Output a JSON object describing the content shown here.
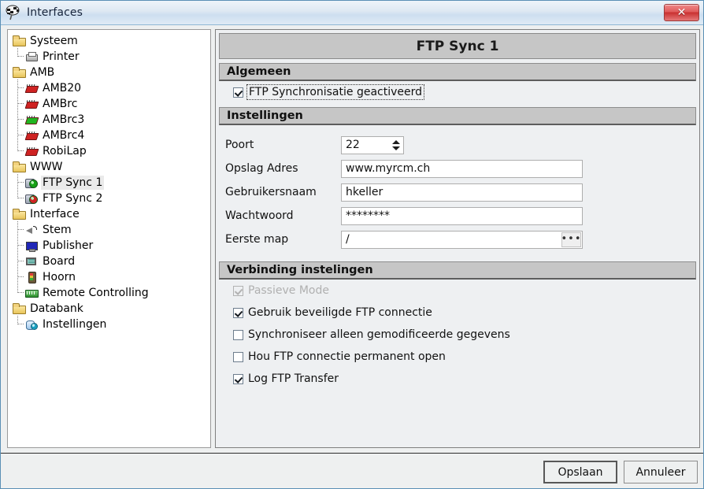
{
  "window": {
    "title": "Interfaces",
    "title_icon": "interfaces-icon",
    "close_label": "✕"
  },
  "tree": {
    "nodes": [
      {
        "label": "Systeem",
        "icon": "folder-icon",
        "level": 0,
        "selected": false
      },
      {
        "label": "Printer",
        "icon": "printer-icon",
        "level": 1,
        "selected": false
      },
      {
        "label": "AMB",
        "icon": "folder-icon",
        "level": 0,
        "selected": false
      },
      {
        "label": "AMB20",
        "icon": "chip-red-icon",
        "level": 1,
        "selected": false
      },
      {
        "label": "AMBrc",
        "icon": "chip-red-icon",
        "level": 1,
        "selected": false
      },
      {
        "label": "AMBrc3",
        "icon": "chip-green-icon",
        "level": 1,
        "selected": false
      },
      {
        "label": "AMBrc4",
        "icon": "chip-red-icon",
        "level": 1,
        "selected": false
      },
      {
        "label": "RobiLap",
        "icon": "chip-red-icon",
        "level": 1,
        "selected": false
      },
      {
        "label": "WWW",
        "icon": "folder-icon",
        "level": 0,
        "selected": false
      },
      {
        "label": "FTP Sync 1",
        "icon": "ftp-green-icon",
        "level": 1,
        "selected": true
      },
      {
        "label": "FTP Sync 2",
        "icon": "ftp-red-icon",
        "level": 1,
        "selected": false
      },
      {
        "label": "Interface",
        "icon": "folder-icon",
        "level": 0,
        "selected": false
      },
      {
        "label": "Stem",
        "icon": "speaker-icon",
        "level": 1,
        "selected": false
      },
      {
        "label": "Publisher",
        "icon": "monitor-icon",
        "level": 1,
        "selected": false
      },
      {
        "label": "Board",
        "icon": "board-icon",
        "level": 1,
        "selected": false
      },
      {
        "label": "Hoorn",
        "icon": "traffic-light-icon",
        "level": 1,
        "selected": false
      },
      {
        "label": "Remote Controlling",
        "icon": "network-icon",
        "level": 1,
        "selected": false
      },
      {
        "label": "Databank",
        "icon": "folder-icon",
        "level": 0,
        "selected": false
      },
      {
        "label": "Instellingen",
        "icon": "database-icon",
        "level": 1,
        "selected": false
      }
    ]
  },
  "detail": {
    "title": "FTP Sync 1",
    "algemeen": {
      "header": "Algemeen",
      "enabled_checkbox": {
        "label": "FTP Synchronisatie geactiveerd",
        "checked": true,
        "focused": true
      }
    },
    "instellingen": {
      "header": "Instellingen",
      "fields": [
        {
          "label": "Poort",
          "value": "22",
          "type": "spinner"
        },
        {
          "label": "Opslag Adres",
          "value": "www.myrcm.ch",
          "type": "text"
        },
        {
          "label": "Gebruikersnaam",
          "value": "hkeller",
          "type": "text"
        },
        {
          "label": "Wachtwoord",
          "value": "********",
          "type": "password"
        },
        {
          "label": "Eerste map",
          "value": "/",
          "type": "browse",
          "browse_label": "•••"
        }
      ]
    },
    "verbinding": {
      "header": "Verbinding instelingen",
      "options": [
        {
          "label": "Passieve Mode",
          "checked": true,
          "disabled": true
        },
        {
          "label": "Gebruik beveiligde FTP connectie",
          "checked": true,
          "disabled": false
        },
        {
          "label": "Synchroniseer alleen gemodificeerde gegevens",
          "checked": false,
          "disabled": false
        },
        {
          "label": "Hou FTP connectie permanent open",
          "checked": false,
          "disabled": false
        },
        {
          "label": "Log FTP Transfer",
          "checked": true,
          "disabled": false
        }
      ]
    }
  },
  "footer": {
    "save_label": "Opslaan",
    "cancel_label": "Annuleer"
  }
}
